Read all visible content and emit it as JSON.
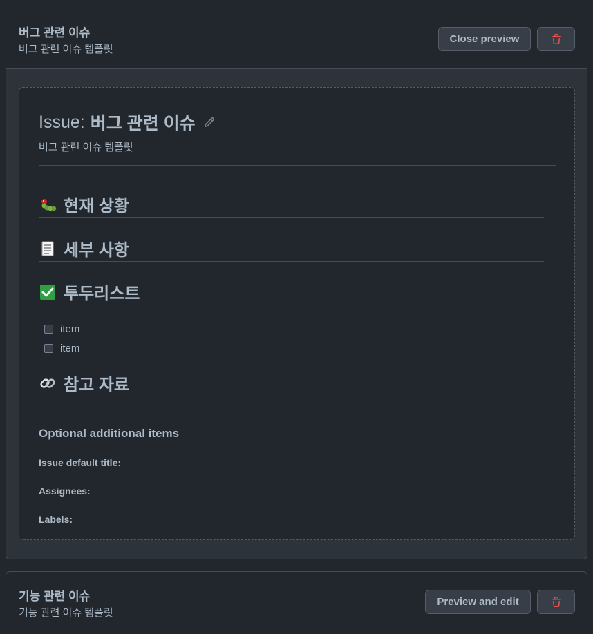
{
  "templates": [
    {
      "name": "버그 관련 이슈",
      "about": "버그 관련 이슈 템플릿",
      "primary_action": "Close preview",
      "preview": {
        "title_prefix": "Issue:",
        "title": "버그 관련 이슈",
        "about": "버그 관련 이슈 템플릿",
        "sections": [
          {
            "emoji": "caterpillar-emoji",
            "heading": "현재 상황"
          },
          {
            "emoji": "page-emoji",
            "heading": "세부 사항"
          },
          {
            "emoji": "check-mark-emoji",
            "heading": "투두리스트"
          },
          {
            "emoji": "link-emoji",
            "heading": "참고 자료"
          }
        ],
        "tasks": [
          {
            "label": "item",
            "checked": false
          },
          {
            "label": "item",
            "checked": false
          }
        ],
        "optional_title": "Optional additional items",
        "optional_fields": {
          "default_title": "Issue default title:",
          "assignees": "Assignees:",
          "labels": "Labels:"
        }
      }
    },
    {
      "name": "기능 관련 이슈",
      "about": "기능 관련 이슈 템플릿",
      "primary_action": "Preview and edit"
    }
  ],
  "colors": {
    "background": "#22272e",
    "card": "#2d333b",
    "border": "#444c56",
    "text": "#adbac7",
    "danger": "#e5534b",
    "check_green": "#2ea043"
  },
  "icons": {
    "delete": "trash-icon",
    "edit": "pencil-icon"
  }
}
